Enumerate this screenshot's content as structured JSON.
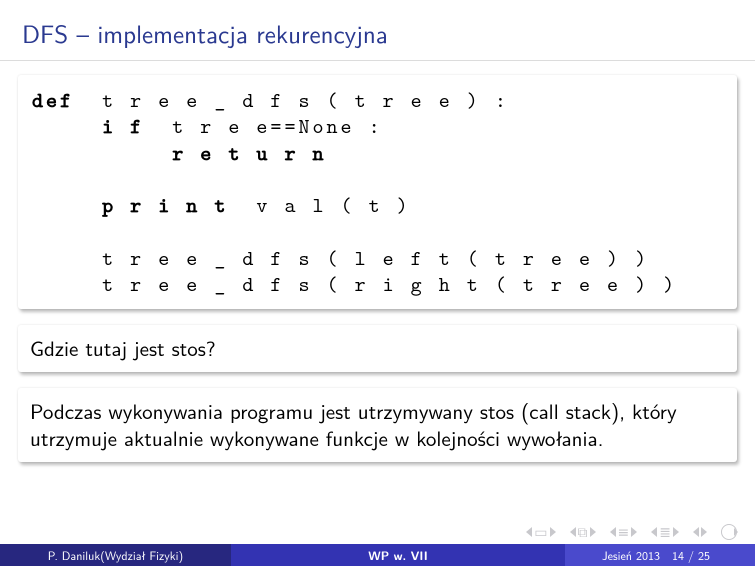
{
  "title": "DFS – implementacja rekurencyjna",
  "code": {
    "l1a": "def",
    "l1b": "  t r e e _ d f s ( t r e e ) :",
    "l2a": "     i f",
    "l2b": "  t r e e==None :",
    "l3a": "          r e t u r n",
    "l4": "",
    "l5a": "     p r i n t",
    "l5b": "  v a l ( t )",
    "l6": "",
    "l7": "     t r e e _ d f s ( l e f t ( t r e e ) )",
    "l8": "     t r e e _ d f s ( r i g h t ( t r e e ) )"
  },
  "question": "Gdzie tutaj jest stos?",
  "answer": "Podczas wykonywania programu jest utrzymywany stos (call stack), który utrzymuje aktualnie wykonywane funkcje w kolejności wywołania.",
  "footer": {
    "author": "P. Daniluk(Wydział Fizyki)",
    "short_title": "WP w. VII",
    "date": "Jesień 2013",
    "page": "14 / 25"
  }
}
